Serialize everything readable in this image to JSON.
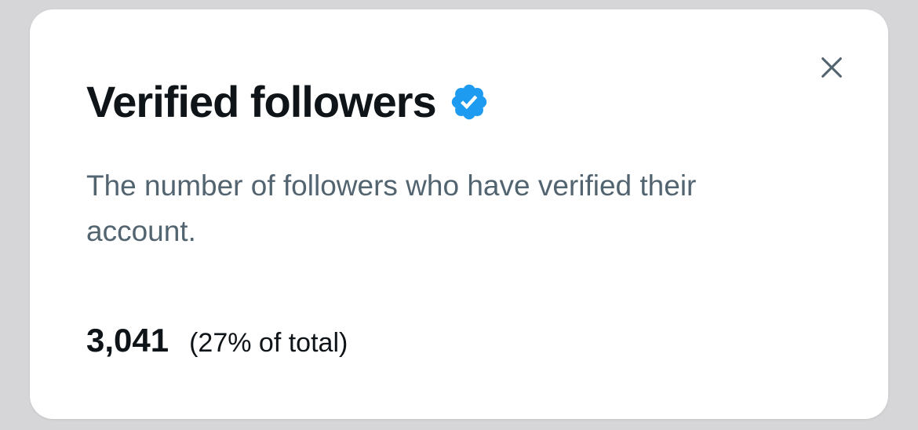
{
  "dialog": {
    "title": "Verified followers",
    "badge_icon": "verified-badge-icon",
    "close_icon": "close-icon",
    "description": "The number of followers who have verified their account.",
    "value": "3,041",
    "percent_label": "(27% of total)"
  },
  "colors": {
    "badge": "#1d9bf0",
    "title_text": "#0f1419",
    "secondary_text": "#536471",
    "close_icon": "#536471",
    "card_background": "#ffffff",
    "backdrop": "#d6d6d8"
  }
}
